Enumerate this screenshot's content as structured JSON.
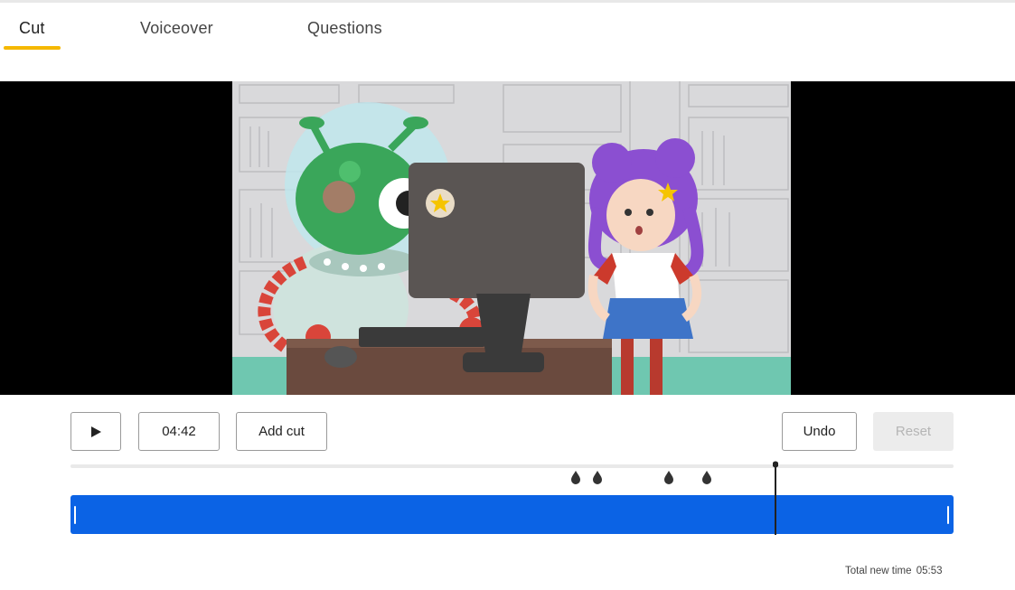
{
  "tabs": [
    {
      "label": "Cut",
      "active": true
    },
    {
      "label": "Voiceover",
      "active": false
    },
    {
      "label": "Questions",
      "active": false
    }
  ],
  "accent_color": "#f5b800",
  "timeline_color": "#0b63e5",
  "video": {
    "content": "cartoon-illustration"
  },
  "controls": {
    "play_icon": "play-icon",
    "current_time": "04:42",
    "add_cut_label": "Add cut",
    "undo_label": "Undo",
    "reset_label": "Reset",
    "reset_disabled": true
  },
  "timeline": {
    "marker_count": 4
  },
  "footer": {
    "total_label": "Total new time",
    "total_value": "05:53"
  }
}
